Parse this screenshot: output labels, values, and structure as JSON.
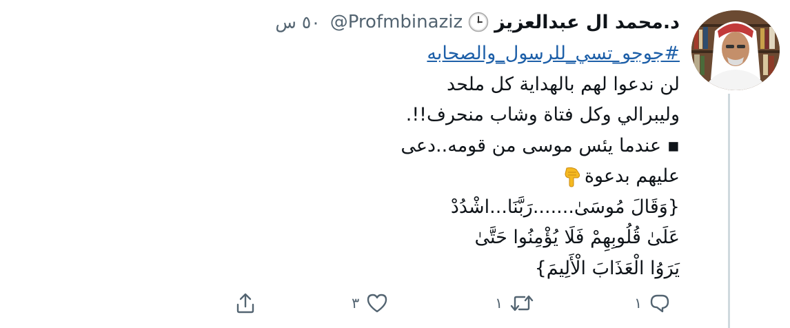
{
  "author": {
    "name": "د.محمد ال عبدالعزيز",
    "handle": "@Profmbinaziz",
    "badge_icon": "clock-icon",
    "time": "٥٠ س"
  },
  "tweet": {
    "hashtag": "#جوجو_تسي_للرسول_والصحابه",
    "lines": [
      "لن ندعوا لهم بالهداية كل ملحد",
      "وليبرالي وكل فتاة وشاب منحرف!!.",
      "▪︎ عندما يئس موسى من قومه..دعى",
      "عليهم بدعوة",
      "{وَقَالَ مُوسَىٰ.......رَبَّنَا...اشْدُدْ",
      "عَلَىٰ قُلُوبِهِمْ فَلَا يُؤْمِنُوا حَتَّىٰ",
      "يَرَوُا الْعَذَابَ الْأَلِيمَ}"
    ],
    "emoji": "pointing-down-hand-icon"
  },
  "actions": {
    "reply_count": "١",
    "retweet_count": "١",
    "like_count": "٣",
    "reply_icon": "reply-icon",
    "retweet_icon": "retweet-icon",
    "like_icon": "heart-icon",
    "share_icon": "share-icon"
  },
  "colors": {
    "hashtag": "#1d5fa8",
    "muted": "#536471",
    "text": "#0f1419",
    "thread_line": "#cfd9de"
  }
}
